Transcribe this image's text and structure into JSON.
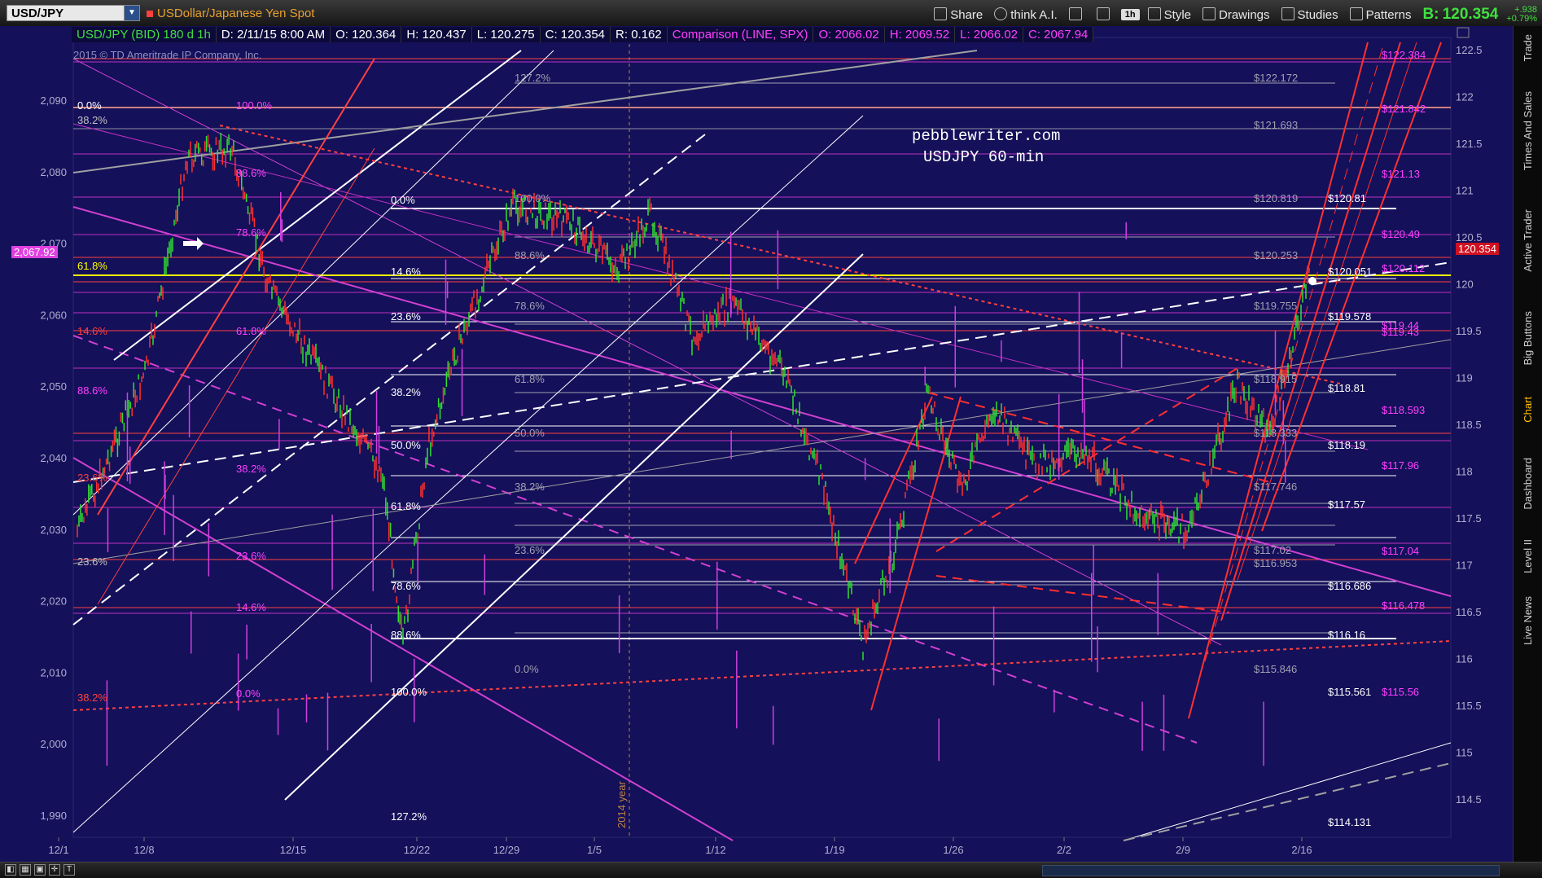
{
  "toolbar": {
    "symbol": "USD/JPY",
    "description": "USDollar/Japanese Yen Spot",
    "buttons": [
      "Share",
      "think A.I.",
      "1h",
      "Style",
      "Drawings",
      "Studies",
      "Patterns"
    ],
    "bid_label": "B:",
    "bid_value": "120.354",
    "change_abs": "+.938",
    "change_pct": "+0.79%"
  },
  "info_bar": {
    "symbol": "USD/JPY (BID) 180 d 1h",
    "date": "D: 2/11/15 8:00 AM",
    "open": "O: 120.364",
    "high": "H: 120.437",
    "low": "L: 120.275",
    "close": "C: 120.354",
    "range": "R: 0.162",
    "comparison": "Comparison (LINE, SPX)",
    "cmp_open": "O: 2066.02",
    "cmp_high": "H: 2069.52",
    "cmp_low": "L: 2066.02",
    "cmp_close": "C: 2067.94"
  },
  "copyright": "2015 © TD Ameritrade IP Company, Inc.",
  "watermark": {
    "line1": "pebblewriter.com",
    "line2": "USDJPY 60-min"
  },
  "current": {
    "left": "2,067.92",
    "right": "120.354"
  },
  "left_axis": [
    "2,090",
    "2,080",
    "2,070",
    "2,060",
    "2,050",
    "2,040",
    "2,030",
    "2,020",
    "2,010",
    "2,000",
    "1,990"
  ],
  "right_axis": [
    "122.5",
    "122",
    "121.5",
    "121",
    "120.5",
    "120",
    "119.5",
    "119",
    "118.5",
    "118",
    "117.5",
    "117",
    "116.5",
    "116",
    "115.5",
    "115",
    "114.5"
  ],
  "x_axis": [
    "12/1",
    "12/8",
    "12/15",
    "12/22",
    "12/29",
    "1/5",
    "1/12",
    "1/19",
    "1/26",
    "2/2",
    "2/9",
    "2/16"
  ],
  "year_marker": "2014 year",
  "fib_left": [
    {
      "t": "0.0%",
      "c": "#ffffff"
    },
    {
      "t": "38.2%",
      "c": "#c0c0c0"
    },
    {
      "t": "61.8%",
      "c": "#ffff00"
    },
    {
      "t": "14.6%",
      "c": "#ff4040"
    },
    {
      "t": "88.6%",
      "c": "#ff40ff"
    },
    {
      "t": "23.6%",
      "c": "#ff4040"
    },
    {
      "t": "23.6%",
      "c": "#c0c0c0"
    },
    {
      "t": "38.2%",
      "c": "#ff4040"
    }
  ],
  "fib_mid_magenta": [
    {
      "t": "100.0%"
    },
    {
      "t": "88.6%"
    },
    {
      "t": "78.6%"
    },
    {
      "t": "61.8%"
    },
    {
      "t": "38.2%"
    },
    {
      "t": "23.6%"
    },
    {
      "t": "14.6%"
    },
    {
      "t": "0.0%"
    }
  ],
  "fib_white": [
    {
      "t": "0.0%"
    },
    {
      "t": "14.6%"
    },
    {
      "t": "23.6%"
    },
    {
      "t": "38.2%"
    },
    {
      "t": "50.0%"
    },
    {
      "t": "61.8%"
    },
    {
      "t": "78.6%"
    },
    {
      "t": "88.6%"
    },
    {
      "t": "100.0%"
    },
    {
      "t": "127.2%"
    }
  ],
  "fib_gray": [
    {
      "t": "127.2%"
    },
    {
      "t": "100.0%"
    },
    {
      "t": "88.6%"
    },
    {
      "t": "78.6%"
    },
    {
      "t": "61.8%"
    },
    {
      "t": "50.0%"
    },
    {
      "t": "38.2%"
    },
    {
      "t": "23.6%"
    },
    {
      "t": "0.0%"
    }
  ],
  "price_labels_gray": [
    "$122.172",
    "$121.693",
    "$120.819",
    "$120.253",
    "$119.755",
    "$118.915",
    "$118.333",
    "$117.746",
    "$117.02",
    "$116.953",
    "$115.846"
  ],
  "price_labels_white": [
    "$120.81",
    "$120.051",
    "$119.578",
    "$118.81",
    "$118.19",
    "$117.57",
    "$116.686",
    "$116.16",
    "$115.561",
    "$114.131"
  ],
  "price_labels_magenta": [
    "$122.384",
    "$121.842",
    "$121.13",
    "$120.49",
    "$120.112",
    "$119.44",
    "$119.43",
    "$118.593",
    "$117.96",
    "$117.04",
    "$116.478",
    "$115.56"
  ],
  "sidenav": [
    "Trade",
    "Times And Sales",
    "Active Trader",
    "Big Buttons",
    "Chart",
    "Dashboard",
    "Level II",
    "Live News"
  ],
  "sidenav_active": "Chart"
}
